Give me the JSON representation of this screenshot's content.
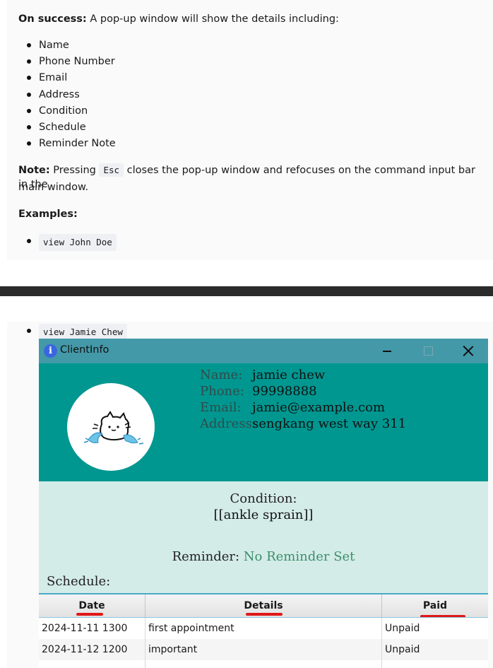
{
  "doc": {
    "success_label": "On success:",
    "success_text": " A pop-up window will show the details including:",
    "bullets": [
      "Name",
      "Phone Number",
      "Email",
      "Address",
      "Condition",
      "Schedule",
      "Reminder Note"
    ],
    "note_label": "Note:",
    "note_text_1": " Pressing ",
    "note_key": "Esc",
    "note_text_2": " closes the pop-up window and refocuses on the command input bar in the",
    "note_text_3": "main window.",
    "examples_label": "Examples:",
    "example_1": "view John Doe",
    "example_2": "view Jamie Chew"
  },
  "window": {
    "title": "ClientInfo",
    "icon": "info-icon",
    "controls": [
      "minimize-icon",
      "maximize-icon",
      "close-icon"
    ]
  },
  "client": {
    "labels": {
      "name": "Name:",
      "phone": "Phone:",
      "email": "Email:",
      "address": "Address:"
    },
    "name": "jamie chew",
    "phone": "99998888",
    "email": "jamie@example.com",
    "address": "sengkang west way 311",
    "avatar": "cat-avatar-icon"
  },
  "condition": {
    "label": "Condition:",
    "value": "[[ankle sprain]]"
  },
  "reminder": {
    "label": "Reminder:",
    "value": " No Reminder Set"
  },
  "schedule": {
    "label": "Schedule:",
    "columns": [
      "Date",
      "Details",
      "Paid"
    ],
    "rows": [
      {
        "date": "2024-11-11 1300",
        "details": "first appointment",
        "paid": "Unpaid"
      },
      {
        "date": "2024-11-12 1200",
        "details": "important",
        "paid": "Unpaid"
      }
    ]
  },
  "colors": {
    "titlebar": "#4499a9",
    "header": "#009790",
    "middle": "#d4ece8",
    "reminder_value": "#3c8f6a",
    "annotation_red": "#e01818"
  }
}
